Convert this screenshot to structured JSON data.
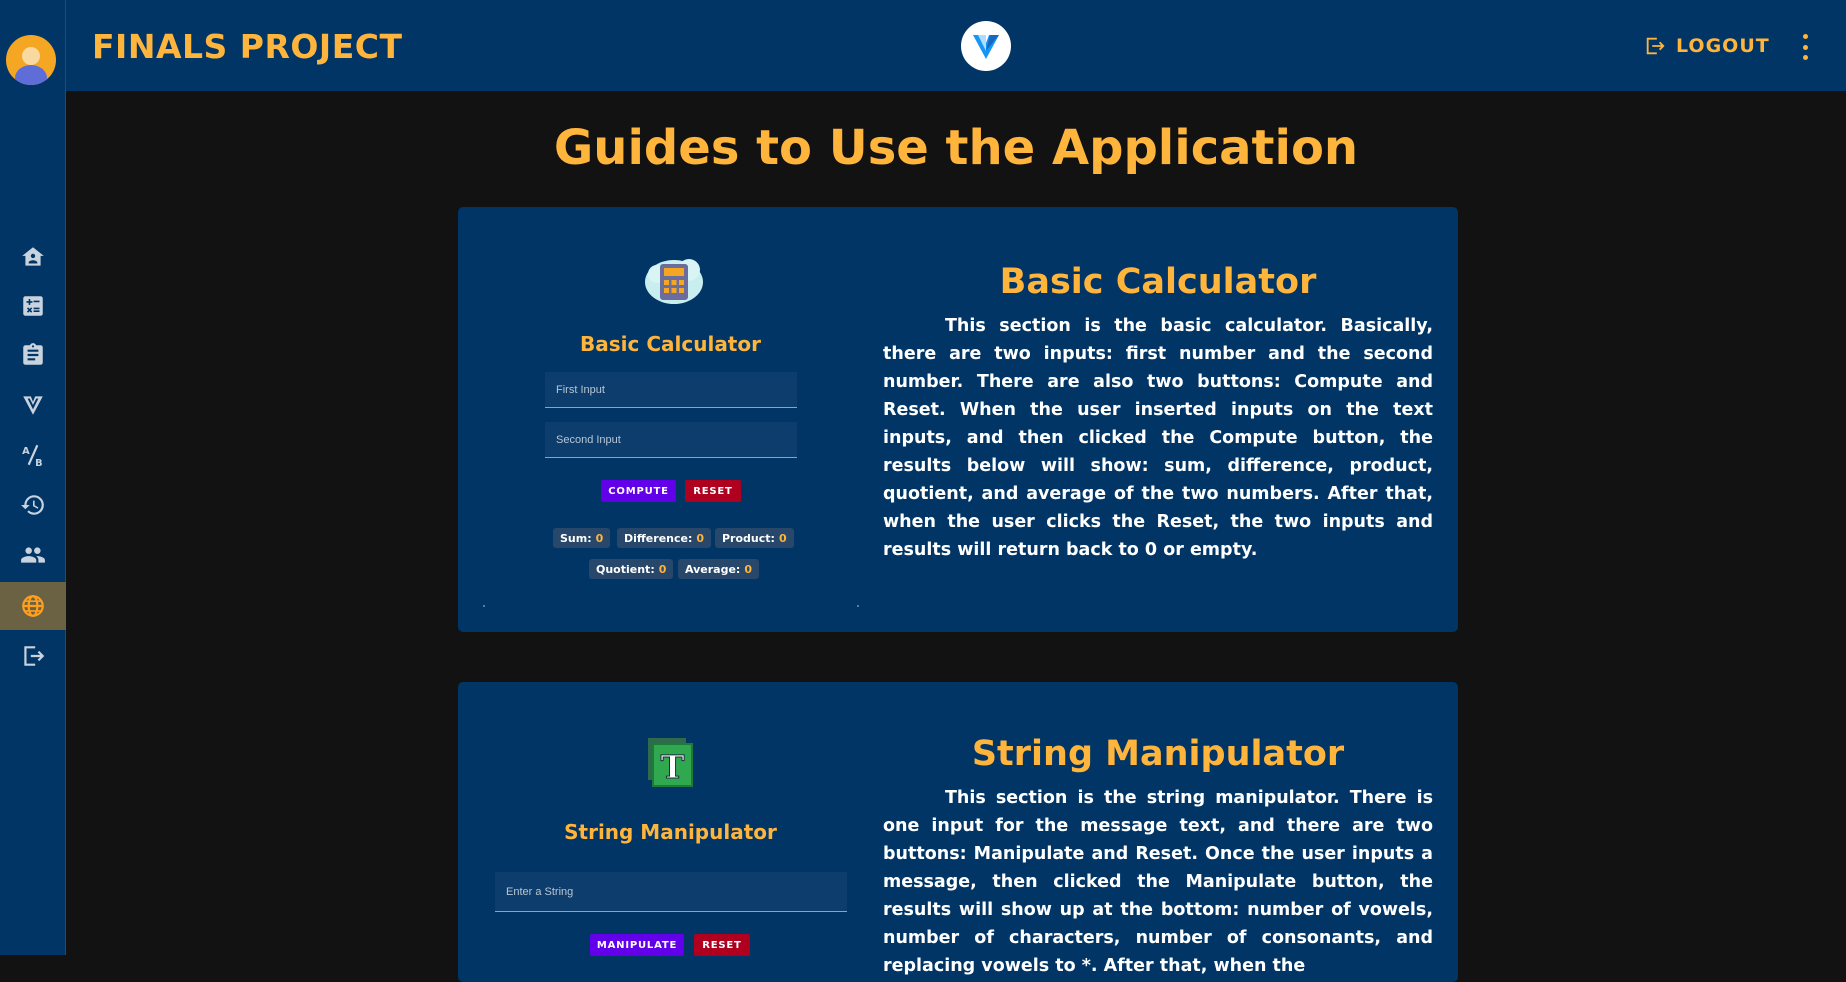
{
  "header": {
    "title": "FINALS PROJECT",
    "logout_label": "LOGOUT"
  },
  "sidebar": {
    "items": [
      {
        "name": "home-icon"
      },
      {
        "name": "calculator-icon"
      },
      {
        "name": "clipboard-icon"
      },
      {
        "name": "vuetify-icon"
      },
      {
        "name": "translate-icon"
      },
      {
        "name": "history-icon"
      },
      {
        "name": "users-icon"
      },
      {
        "name": "globe-icon",
        "active": true
      },
      {
        "name": "logout-icon"
      }
    ]
  },
  "main": {
    "heading": "Guides to Use the Application",
    "calculator": {
      "preview_title": "Basic Calculator",
      "first_placeholder": "First Input",
      "second_placeholder": "Second Input",
      "compute_label": "COMPUTE",
      "reset_label": "RESET",
      "results": [
        {
          "label": "Sum:",
          "value": "0"
        },
        {
          "label": "Difference:",
          "value": "0"
        },
        {
          "label": "Product:",
          "value": "0"
        },
        {
          "label": "Quotient:",
          "value": "0"
        },
        {
          "label": "Average:",
          "value": "0"
        }
      ],
      "title": "Basic Calculator",
      "description": "This section is the basic calculator. Basically, there are two inputs: first number and the second number. There are also two buttons: Compute and Reset. When the user inserted inputs on the text inputs, and then clicked the Compute button, the results below will show: sum, difference, product, quotient, and average of the two numbers. After that, when the user clicks the Reset, the two inputs and results will return back to 0 or empty."
    },
    "string": {
      "preview_title": "String Manipulator",
      "input_placeholder": "Enter a String",
      "manipulate_label": "MANIPULATE",
      "reset_label": "RESET",
      "title": "String Manipulator",
      "description": "This section is the string manipulator. There is one input for the message text, and there are two buttons: Manipulate and Reset. Once the user inputs a message, then clicked the Manipulate button, the results will show up at the bottom: number of vowels, number of characters, number of consonants, and replacing vowels to *. After that, when the"
    }
  },
  "colors": {
    "accent": "#ffb43c",
    "panel": "#003566",
    "background": "#121212",
    "primary_button": "#6200ea",
    "danger_button": "#b00020"
  }
}
